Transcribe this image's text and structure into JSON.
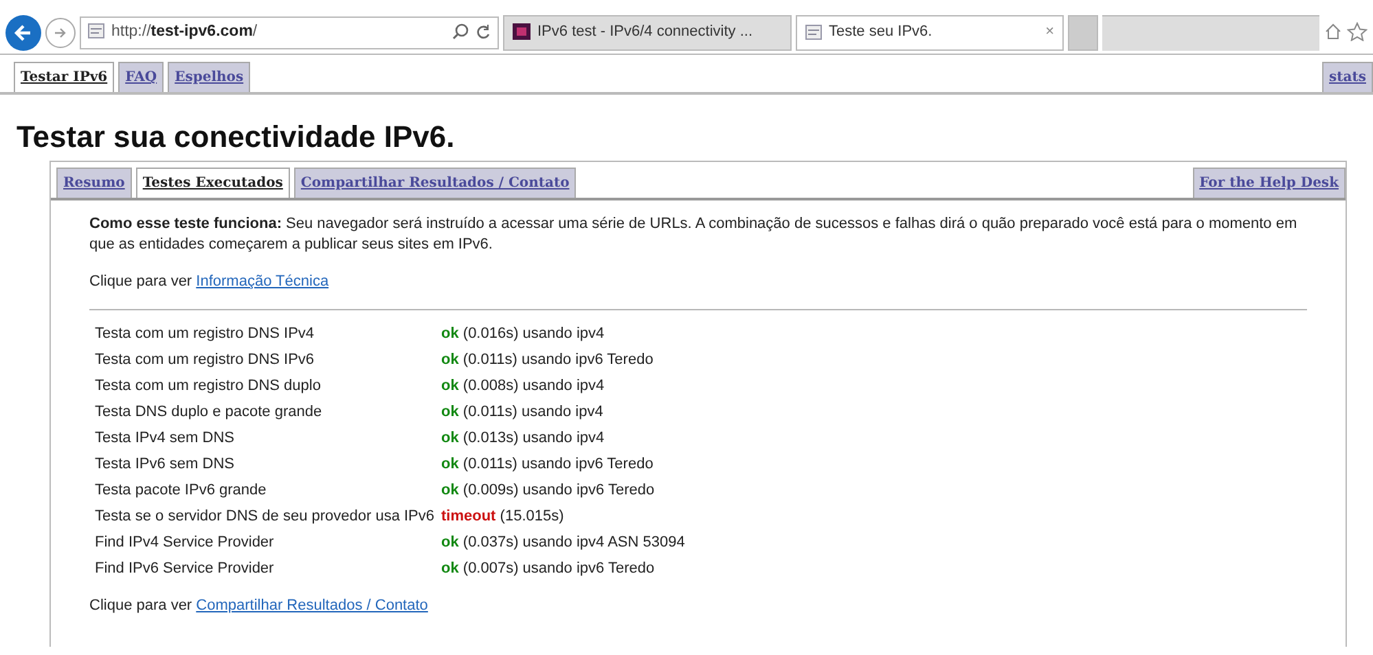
{
  "browser": {
    "url_prefix": "http://",
    "url_host": "test-ipv6.com",
    "url_suffix": "/",
    "tabs": [
      {
        "title": "IPv6 test - IPv6/4 connectivity ...",
        "selected": false
      },
      {
        "title": "Teste seu IPv6.",
        "selected": true,
        "close": "×"
      }
    ]
  },
  "site_tabs": [
    {
      "label": "Testar IPv6",
      "selected": true
    },
    {
      "label": "FAQ",
      "selected": false
    },
    {
      "label": "Espelhos",
      "selected": false
    }
  ],
  "stats_tab": {
    "label": "stats"
  },
  "heading": "Testar sua conectividade IPv6.",
  "panel_tabs": [
    {
      "label": "Resumo",
      "selected": false
    },
    {
      "label": "Testes Executados",
      "selected": true
    },
    {
      "label": "Compartilhar Resultados / Contato",
      "selected": false
    }
  ],
  "help_desk_tab": {
    "label": "For the Help Desk"
  },
  "intro": "**Como esse teste funciona:** Seu navegador será instruído a acessar uma série de URLs. A combinação de sucessos e falhas dirá o quão preparado você está para o momento em que as entidades começarem a publicar seus sites em IPv6.",
  "tech_link": {
    "prefix": "Clique para ver",
    "link": "Informação Técnica"
  },
  "tests": [
    {
      "name": "Testa com um registro DNS IPv4",
      "kind": "ok",
      "status": "ok",
      "detail": "(0.016s) usando ipv4"
    },
    {
      "name": "Testa com um registro DNS IPv6",
      "kind": "ok",
      "status": "ok",
      "detail": "(0.011s) usando ipv6 Teredo"
    },
    {
      "name": "Testa com um registro DNS duplo",
      "kind": "ok",
      "status": "ok",
      "detail": "(0.008s) usando ipv4"
    },
    {
      "name": "Testa DNS duplo e pacote grande",
      "kind": "ok",
      "status": "ok",
      "detail": "(0.011s) usando ipv4"
    },
    {
      "name": "Testa IPv4 sem DNS",
      "kind": "ok",
      "status": "ok",
      "detail": "(0.013s) usando ipv4"
    },
    {
      "name": "Testa IPv6 sem DNS",
      "kind": "ok",
      "status": "ok",
      "detail": "(0.011s) usando ipv6 Teredo"
    },
    {
      "name": "Testa pacote IPv6 grande",
      "kind": "ok",
      "status": "ok",
      "detail": "(0.009s) usando ipv6 Teredo"
    },
    {
      "name": "Testa se o servidor DNS de seu provedor usa IPv6",
      "kind": "timeout",
      "status": "timeout",
      "detail": "(15.015s)"
    },
    {
      "name": "Find IPv4 Service Provider",
      "kind": "ok",
      "status": "ok",
      "detail": "(0.037s) usando ipv4 ASN 53094"
    },
    {
      "name": "Find IPv6 Service Provider",
      "kind": "ok",
      "status": "ok",
      "detail": "(0.007s) usando ipv6 Teredo"
    }
  ],
  "share_link": {
    "prefix": "Clique para ver",
    "link": "Compartilhar Resultados / Contato"
  }
}
